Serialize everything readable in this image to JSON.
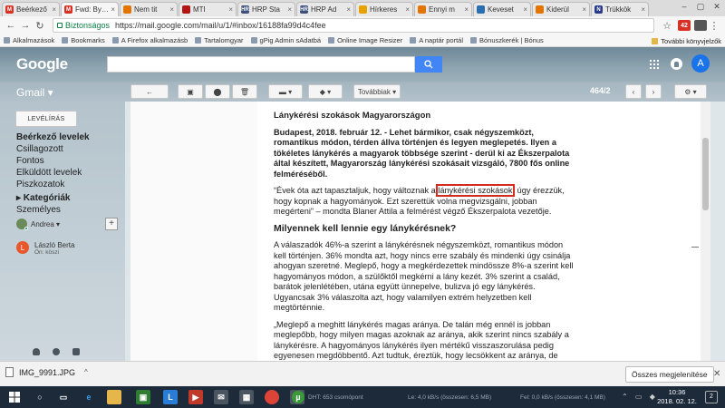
{
  "browser": {
    "tabs": [
      {
        "label": "Beérkező",
        "fav_color": "#d93025",
        "fav_letter": "M",
        "active": false
      },
      {
        "label": "Fwd: ByGe",
        "fav_color": "#d93025",
        "fav_letter": "M",
        "active": true
      },
      {
        "label": "Nem tit",
        "fav_color": "#e37400",
        "fav_letter": "",
        "active": false
      },
      {
        "label": "MTI",
        "fav_color": "#b31412",
        "fav_letter": "",
        "active": false
      },
      {
        "label": "HRP Sta",
        "fav_color": "#3c4e7a",
        "fav_letter": "HR",
        "active": false
      },
      {
        "label": "HRP Ad",
        "fav_color": "#3c4e7a",
        "fav_letter": "HR",
        "active": false
      },
      {
        "label": "Hírkeres",
        "fav_color": "#e8a200",
        "fav_letter": "",
        "active": false
      },
      {
        "label": "Ennyi m",
        "fav_color": "#e37400",
        "fav_letter": "",
        "active": false
      },
      {
        "label": "Keveset",
        "fav_color": "#2a6db0",
        "fav_letter": "",
        "active": false
      },
      {
        "label": "Kiderül",
        "fav_color": "#e37400",
        "fav_letter": "",
        "active": false
      },
      {
        "label": "Trükkök",
        "fav_color": "#2a3a8a",
        "fav_letter": "N",
        "active": false
      }
    ],
    "secure_label": "Biztonságos",
    "url": "https://mail.google.com/mail/u/1/#inbox/16188fa99d4c4fee",
    "bookmarks": [
      "Alkalmazások",
      "Bookmarks",
      "A Firefox alkalmazásb",
      "Tartalomgyar",
      "gPig Admin sAdatbá",
      "Online Image Resizer",
      "A naptár portál",
      "Bónuszkerék | Bónus"
    ],
    "bookmarks_other": "További könyvjelzők",
    "ext_badge": "42"
  },
  "gmail": {
    "logo": "Google",
    "label": "Gmail",
    "more_label": "Továbbiak",
    "pager": "464/2",
    "compose_label": "LEVÉLÍRÁS",
    "folders": [
      {
        "label": "Beérkező levelek",
        "bold": true
      },
      {
        "label": "Csillagozott",
        "bold": false
      },
      {
        "label": "Fontos",
        "bold": false
      },
      {
        "label": "Elküldött levelek",
        "bold": false
      },
      {
        "label": "Piszkozatok",
        "bold": false
      },
      {
        "label": "Kategóriák",
        "bold": true
      },
      {
        "label": "Személyes",
        "bold": false
      }
    ],
    "chat_self": "Andrea",
    "avatar_letter": "A",
    "contact": {
      "name": "László Berta",
      "message": "Ön: köszi",
      "initial": "L"
    }
  },
  "email": {
    "heading": "Lánykérési szokások Magyarországon",
    "lead": "Budapest, 2018. február 12. - Lehet bármikor, csak négyszemközt, romantikus módon, térden állva történjen és legyen meglepetés. Ilyen a tökéletes lánykérés a magyarok többsége szerint - derül ki az Ékszerpalota által készített, Magyarország lánykérési szokásait vizsgáló, 7800 fős online felméréséből.",
    "quote_before": "“Évek óta azt tapasztaljuk, hogy változnak a ",
    "quote_highlight": "lánykérési szokások",
    "quote_after": ", úgy érezzük, hogy kopnak a hagyományok. Ezt szerettük volna megvizsgálni, jobban megérteni” – mondta Blaner Attila a felmérést végző Ékszerpalota vezetője.",
    "subheading": "Milyennek kell lennie egy lánykérésnek?",
    "para1": "A válaszadók 46%-a szerint a lánykérésnek négyszemközt, romantikus módon kell történjen. 36% mondta azt, hogy nincs erre szabály és mindenki úgy csinálja ahogyan szeretné. Meglepő, hogy a megkérdezettek mindössze 8%-a szerint kell hagyományos módon, a szülőktől megkérni a lány kezét. 3% szerint a család, barátok jelenlétében, utána együtt ünnepelve, bulizva jó egy lánykérés. Ugyancsak 3% válaszolta azt, hogy valamilyen extrém helyzetben kell megtörténnie.",
    "para2": "„Meglepő a meghitt lánykérés magas aránya. De talán még ennél is jobban meglepőbb, hogy milyen magas azoknak az aránya, akik szerint nincs szabály a lánykérésre. A hagyományos lánykérés ilyen mértékű visszaszorulása pedig egyenesen megdöbbentő. Azt tudtuk, éreztük, hogy lecsökkent az aránya, de hogy ennyire, azt nem gondoltuk volna” – mondta Blaner Attila."
  },
  "downloads": {
    "file": "IMG_9991.JPG",
    "show_all": "Összes megjelenítése"
  },
  "taskbar": {
    "task1": "DHT: 653 csomópont",
    "task2": "Le: 4,0 kB/s (összesen: 6,5 MB)",
    "task3": "Fel: 0,0 kB/s (összesen: 4,1 MB)",
    "time": "10:36",
    "date": "2018. 02. 12.",
    "notif_count": "2"
  }
}
